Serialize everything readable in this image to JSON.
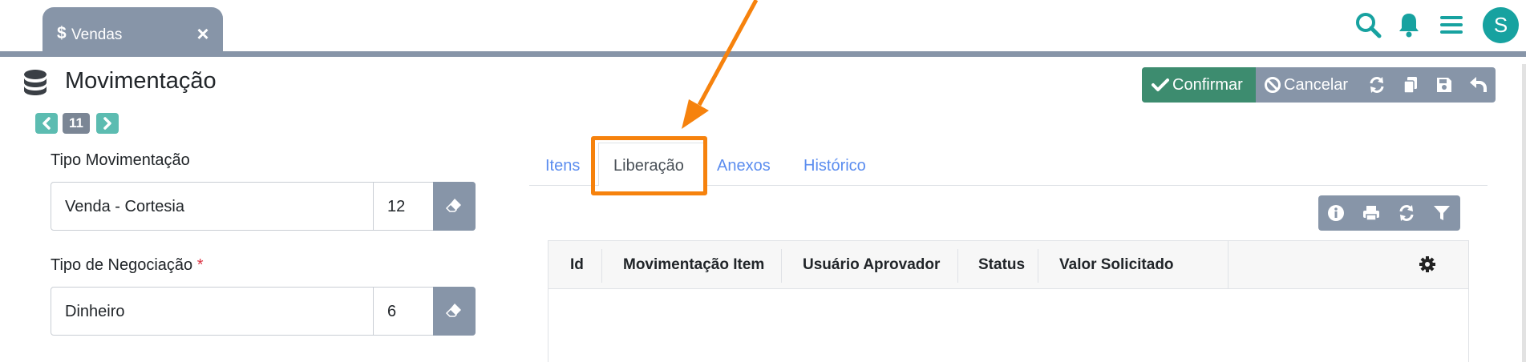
{
  "topbar": {
    "tab_icon": "$",
    "tab_label": "Vendas",
    "tab_close": "×",
    "icons": [
      "search-icon",
      "bell-icon",
      "menu-icon"
    ],
    "avatar_initial": "S"
  },
  "header": {
    "icon": "database-icon",
    "title": "Movimentação",
    "pager": {
      "prev": "‹",
      "current": "11",
      "next": "›"
    }
  },
  "actions": {
    "confirm_label": "Confirmar",
    "cancel_label": "Cancelar",
    "icons": [
      "refresh-icon",
      "copy-icon",
      "save-icon",
      "undo-icon"
    ]
  },
  "form": {
    "tipo_movimentacao": {
      "label": "Tipo Movimentação",
      "value": "Venda - Cortesia",
      "code": "12"
    },
    "tipo_negociacao": {
      "label": "Tipo de Negociação",
      "required_mark": "*",
      "value": "Dinheiro",
      "code": "6"
    }
  },
  "tabs": [
    {
      "label": "Itens",
      "active": false
    },
    {
      "label": "Liberação",
      "active": true
    },
    {
      "label": "Anexos",
      "active": false
    },
    {
      "label": "Histórico",
      "active": false
    }
  ],
  "grid_toolbar": {
    "icons": [
      "info-icon",
      "print-icon",
      "refresh-icon",
      "filter-icon"
    ]
  },
  "table": {
    "columns": [
      "Id",
      "Movimentação Item",
      "Usuário Aprovador",
      "Status",
      "Valor Solicitado"
    ],
    "rows": []
  },
  "colors": {
    "accent": "#17a2a0",
    "tab_bar": "#8795a8",
    "confirm": "#3d8c6f",
    "highlight": "#f6820d",
    "link": "#5b8def"
  }
}
